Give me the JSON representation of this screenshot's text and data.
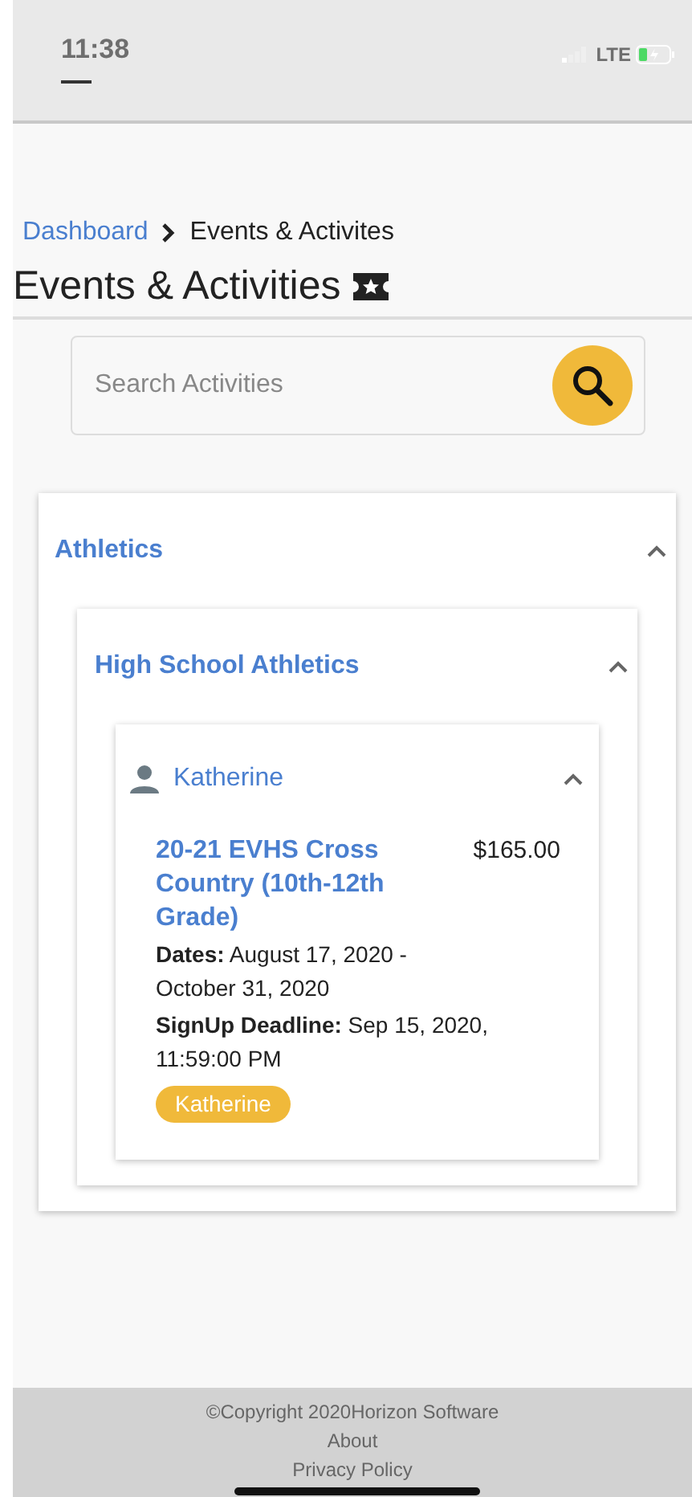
{
  "status_bar": {
    "time": "11:38",
    "network": "LTE"
  },
  "breadcrumb": [
    {
      "label": "Dashboard",
      "kind": "link"
    },
    {
      "label": "Events & Activites",
      "kind": "current"
    }
  ],
  "page_title": "Events & Activities",
  "search": {
    "placeholder": "Search Activities"
  },
  "groups": [
    {
      "title": "Athletics",
      "expanded": true,
      "children": [
        {
          "title": "High School Athletics",
          "expanded": true,
          "children": [
            {
              "person": "Katherine",
              "expanded": true,
              "activities": [
                {
                  "title": "20-21 EVHS Cross Country (10th-12th Grade)",
                  "price": "$165.00",
                  "dates": "**Dates:** August 17, 2020 - October 31, 2020",
                  "deadline": "**SignUp Deadline:** Sep 15, 2020, 11:59:00 PM",
                  "tag": "Katherine"
                }
              ]
            }
          ]
        }
      ]
    }
  ],
  "footer": {
    "copyright": "©Copyright 2020Horizon Software",
    "links": [
      "About",
      "Privacy Policy"
    ]
  }
}
